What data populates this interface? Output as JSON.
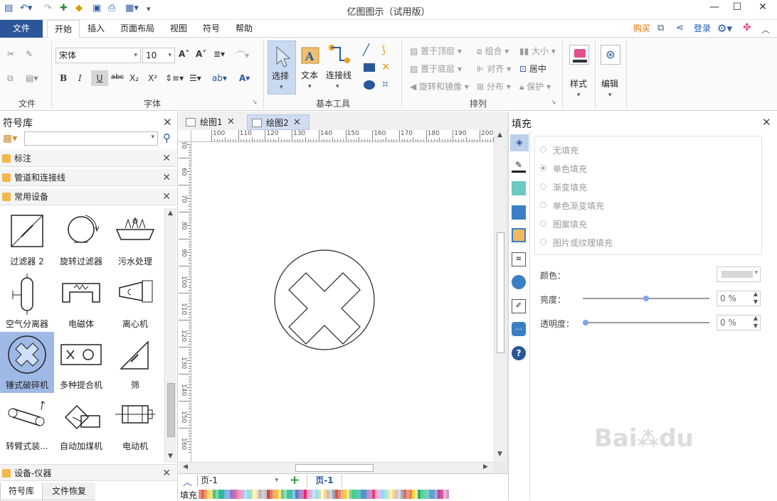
{
  "window": {
    "title": "亿图图示（试用版）"
  },
  "menu": {
    "file": "文件",
    "tabs": [
      "开始",
      "插入",
      "页面布局",
      "视图",
      "符号",
      "帮助"
    ],
    "right": {
      "buy": "购买",
      "login": "登录"
    }
  },
  "ribbon": {
    "file_group": {
      "label": "文件"
    },
    "font_group": {
      "label": "字体",
      "font_name": "宋体",
      "font_size": "10"
    },
    "tools_group": {
      "label": "基本工具",
      "select": "选择",
      "text": "文本",
      "connector": "连接线"
    },
    "arrange_group": {
      "label": "排列",
      "bring_front": "置于顶层",
      "send_back": "置于底层",
      "rotate_mirror": "旋转和镜像",
      "group": "组合",
      "align": "对齐",
      "distribute": "分布",
      "size": "大小",
      "center": "居中",
      "protect": "保护"
    },
    "style": "样式",
    "edit": "编辑"
  },
  "library": {
    "title": "符号库",
    "categories": [
      "标注",
      "管道和连接线",
      "常用设备"
    ],
    "shapes": [
      "过滤器 2",
      "旋转过滤器",
      "污水处理",
      "空气分离器",
      "电磁体",
      "离心机",
      "锤式破碎机",
      "多种提合机",
      "筛",
      "转臂式装...",
      "自动加煤机",
      "电动机"
    ],
    "bottom_category": "设备-仪器",
    "bottom_tabs": [
      "符号库",
      "文件恢复"
    ]
  },
  "canvas": {
    "doc_tabs": [
      "绘图1",
      "绘图2"
    ],
    "ruler_h": [
      "100",
      "110",
      "120",
      "130",
      "140",
      "150",
      "160",
      "170",
      "180",
      "190",
      "200"
    ],
    "ruler_v": [
      "50",
      "60",
      "70",
      "80",
      "90",
      "100",
      "110",
      "120",
      "130",
      "140",
      "150",
      "160"
    ],
    "page_selector": "页-1",
    "page_tab": "页-1",
    "fill_label": "填充"
  },
  "fill_panel": {
    "title": "填充",
    "options": [
      "无填充",
      "单色填充",
      "渐变填充",
      "单色渐变填充",
      "图案填充",
      "图片或纹理填充"
    ],
    "selected_option": "单色填充",
    "color_label": "颜色：",
    "brightness_label": "亮度：",
    "brightness_value": "0 %",
    "transparency_label": "透明度：",
    "transparency_value": "0 %",
    "brightness_level": 0.5,
    "transparency_level": 0.0
  },
  "colors": {
    "accent": "#2b579a",
    "buy": "#e07000",
    "login": "#1a5fb4",
    "selected_shape": "#9fb9e6"
  }
}
